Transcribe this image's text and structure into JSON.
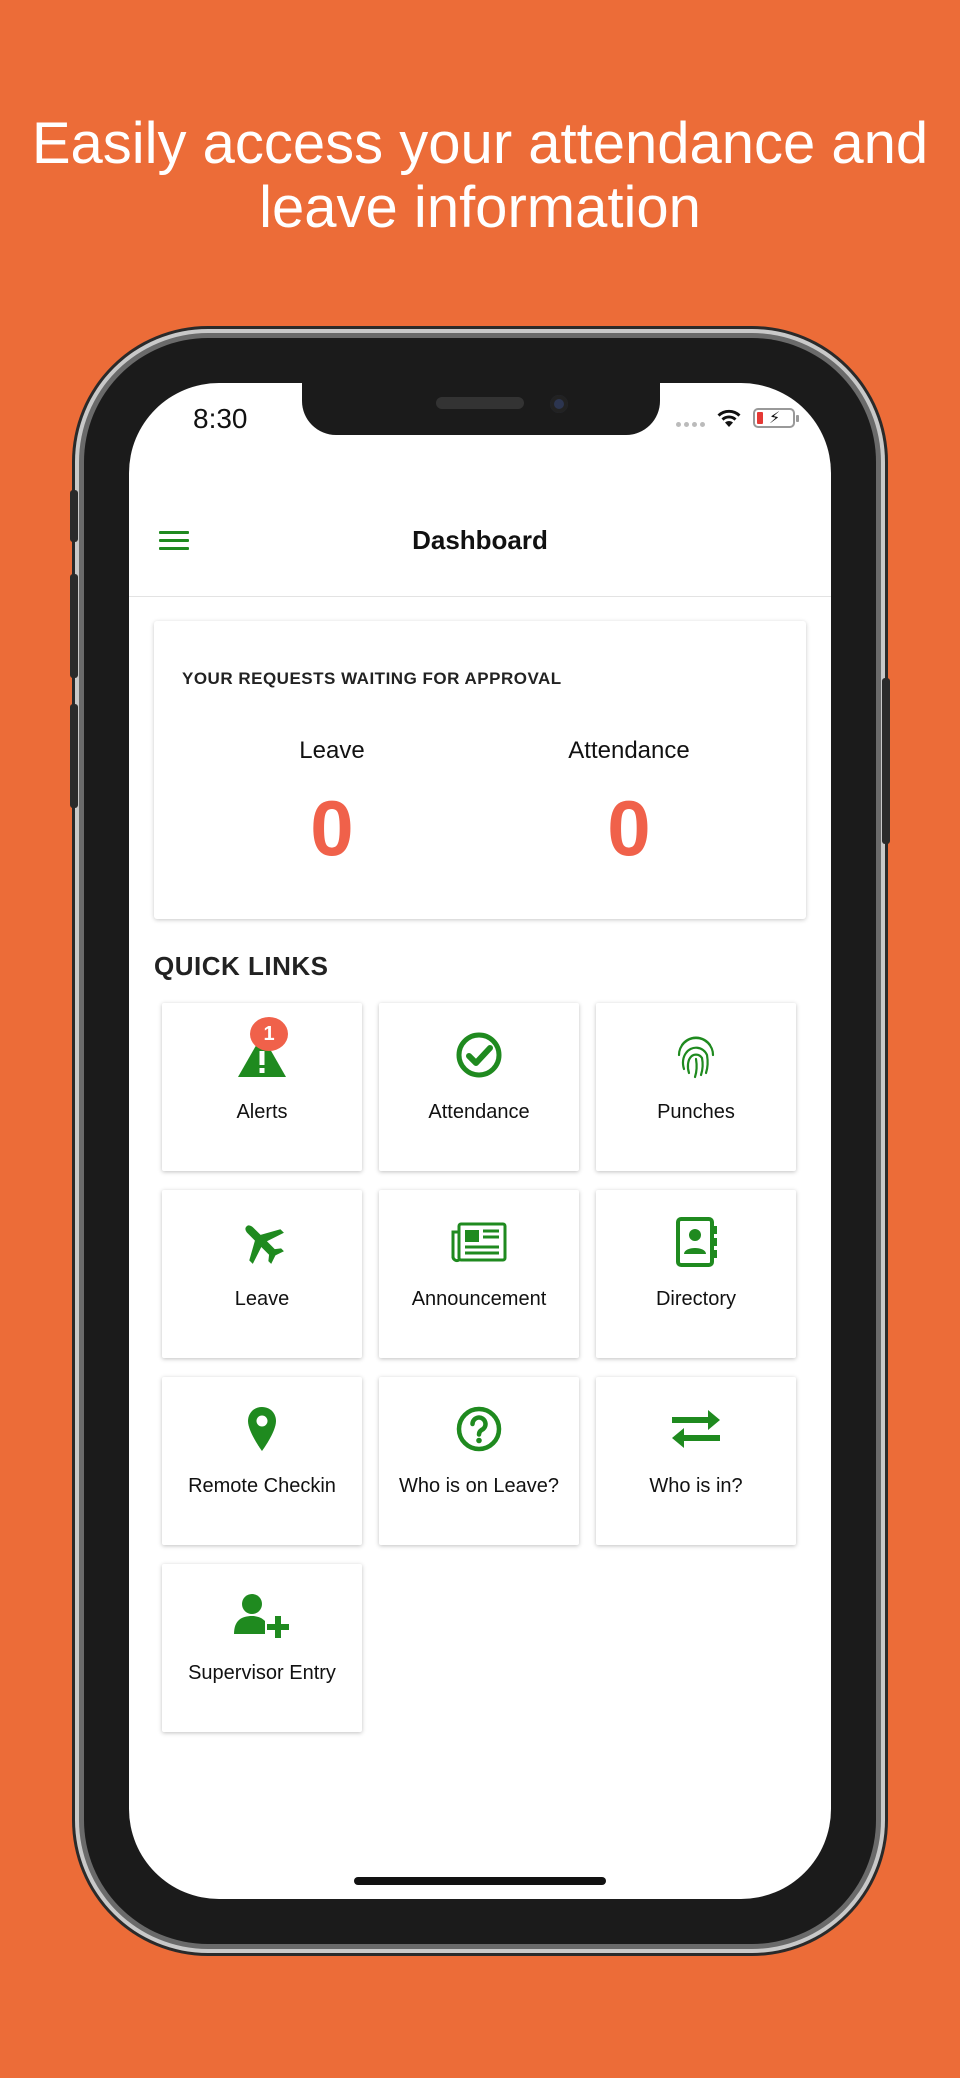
{
  "headline": "Easily access your attendance and leave information",
  "status_bar": {
    "time": "8:30"
  },
  "app_bar": {
    "title": "Dashboard"
  },
  "requests": {
    "title": "YOUR REQUESTS WAITING FOR APPROVAL",
    "leave_label": "Leave",
    "leave_value": "0",
    "attendance_label": "Attendance",
    "attendance_value": "0"
  },
  "quick_links": {
    "title": "QUICK LINKS",
    "items": [
      {
        "label": "Alerts",
        "icon": "alert-icon",
        "badge": "1"
      },
      {
        "label": "Attendance",
        "icon": "check-circle-icon"
      },
      {
        "label": "Punches",
        "icon": "fingerprint-icon"
      },
      {
        "label": "Leave",
        "icon": "airplane-icon"
      },
      {
        "label": "Announcement",
        "icon": "newspaper-icon"
      },
      {
        "label": "Directory",
        "icon": "contact-book-icon"
      },
      {
        "label": "Remote Checkin",
        "icon": "map-pin-icon"
      },
      {
        "label": "Who is on Leave?",
        "icon": "question-circle-icon"
      },
      {
        "label": "Who is in?",
        "icon": "swap-arrows-icon"
      },
      {
        "label": "Supervisor Entry",
        "icon": "user-plus-icon"
      }
    ]
  },
  "colors": {
    "background": "#EC6C38",
    "accent": "#1F8A1F",
    "count": "#F0614A"
  }
}
